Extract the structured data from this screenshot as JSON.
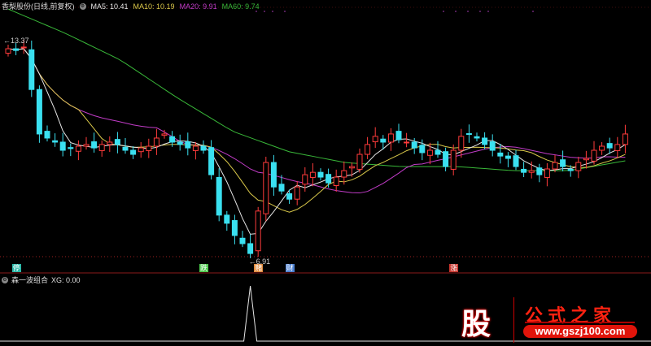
{
  "header": {
    "title": "香梨股份(日线,前复权)",
    "ma5": "MA5: 10.41",
    "ma10": "MA10: 10.19",
    "ma20": "MA20: 9.91",
    "ma60": "MA60: 9.74"
  },
  "colors": {
    "up": "#ff3b3b",
    "down": "#3ae0f0",
    "ma5": "#e6e6e6",
    "ma10": "#d9c84a",
    "ma20": "#c23cc8",
    "ma60": "#39b839"
  },
  "price_labels": {
    "high": "13.37",
    "low": "6.91"
  },
  "price_range": [
    6.5,
    14.5
  ],
  "closes": [
    13.13,
    13.08,
    13.18,
    11.93,
    10.62,
    10.5,
    10.38,
    10.14,
    10.19,
    10.26,
    10.31,
    10.21,
    10.31,
    10.38,
    10.31,
    10.14,
    10.02,
    10.21,
    10.26,
    10.5,
    10.62,
    10.38,
    10.31,
    10.21,
    10.26,
    10.14,
    9.42,
    8.23,
    7.99,
    7.63,
    7.39,
    7.1,
    8.35,
    9.78,
    9.06,
    8.94,
    8.7,
    9.06,
    9.42,
    9.49,
    9.35,
    9.18,
    9.35,
    9.54,
    9.66,
    10.02,
    10.31,
    10.55,
    10.38,
    10.62,
    10.45,
    10.38,
    10.21,
    10.07,
    10.14,
    10.02,
    9.66,
    10.14,
    10.55,
    10.62,
    10.5,
    10.31,
    10.14,
    9.97,
    9.9,
    9.66,
    9.49,
    9.54,
    9.42,
    9.59,
    9.78,
    9.66,
    9.54,
    9.78,
    9.9,
    10.14,
    10.26,
    10.21,
    10.31,
    10.62
  ],
  "ma60_keys": [
    14.3,
    13.6,
    12.8,
    11.7,
    10.7,
    10.1,
    9.78,
    9.66,
    9.66,
    9.54,
    9.54,
    9.83
  ],
  "signals": [
    {
      "label": "停",
      "color": "#2bb8a8",
      "index": 1
    },
    {
      "label": "跌",
      "color": "#4bc84b",
      "index": 25
    },
    {
      "label": "赌",
      "color": "#e08a3c",
      "index": 32
    },
    {
      "label": "财",
      "color": "#4a7fd0",
      "index": 36
    },
    {
      "label": "涨",
      "color": "#c8342c",
      "index": 57
    }
  ],
  "indicator": {
    "name": "森一波组合",
    "xg": "XG: 0.00",
    "spike_index": 31
  },
  "logo": {
    "char": "股",
    "name": "公式之家",
    "url": "www.gszj100.com"
  }
}
